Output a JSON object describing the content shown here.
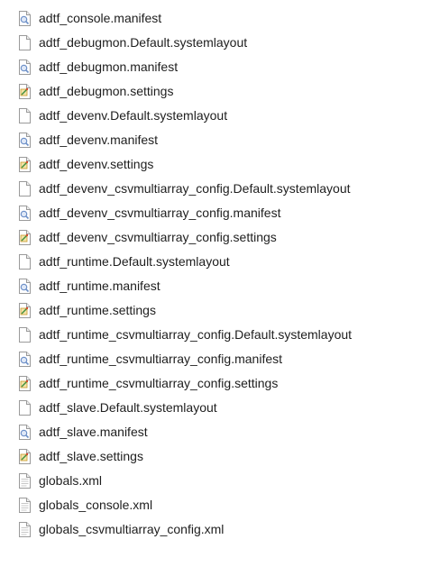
{
  "window": {
    "title": ""
  },
  "file_list": {
    "items": [
      {
        "name": "adtf_console.manifest",
        "icon": "manifest-file-icon"
      },
      {
        "name": "adtf_debugmon.Default.systemlayout",
        "icon": "blank-file-icon"
      },
      {
        "name": "adtf_debugmon.manifest",
        "icon": "manifest-file-icon"
      },
      {
        "name": "adtf_debugmon.settings",
        "icon": "settings-file-icon"
      },
      {
        "name": "adtf_devenv.Default.systemlayout",
        "icon": "blank-file-icon"
      },
      {
        "name": "adtf_devenv.manifest",
        "icon": "manifest-file-icon"
      },
      {
        "name": "adtf_devenv.settings",
        "icon": "settings-file-icon"
      },
      {
        "name": "adtf_devenv_csvmultiarray_config.Default.systemlayout",
        "icon": "blank-file-icon"
      },
      {
        "name": "adtf_devenv_csvmultiarray_config.manifest",
        "icon": "manifest-file-icon"
      },
      {
        "name": "adtf_devenv_csvmultiarray_config.settings",
        "icon": "settings-file-icon"
      },
      {
        "name": "adtf_runtime.Default.systemlayout",
        "icon": "blank-file-icon"
      },
      {
        "name": "adtf_runtime.manifest",
        "icon": "manifest-file-icon"
      },
      {
        "name": "adtf_runtime.settings",
        "icon": "settings-file-icon"
      },
      {
        "name": "adtf_runtime_csvmultiarray_config.Default.systemlayout",
        "icon": "blank-file-icon"
      },
      {
        "name": "adtf_runtime_csvmultiarray_config.manifest",
        "icon": "manifest-file-icon"
      },
      {
        "name": "adtf_runtime_csvmultiarray_config.settings",
        "icon": "settings-file-icon"
      },
      {
        "name": "adtf_slave.Default.systemlayout",
        "icon": "blank-file-icon"
      },
      {
        "name": "adtf_slave.manifest",
        "icon": "manifest-file-icon"
      },
      {
        "name": "adtf_slave.settings",
        "icon": "settings-file-icon"
      },
      {
        "name": "globals.xml",
        "icon": "xml-file-icon"
      },
      {
        "name": "globals_console.xml",
        "icon": "xml-file-icon"
      },
      {
        "name": "globals_csvmultiarray_config.xml",
        "icon": "xml-file-icon"
      }
    ]
  },
  "colors": {
    "background": "#ffffff",
    "text": "#1e1e1e",
    "icon_border": "#9a9a9a",
    "manifest_accent": "#6c8fc7",
    "settings_accent": "#d9a62b"
  }
}
